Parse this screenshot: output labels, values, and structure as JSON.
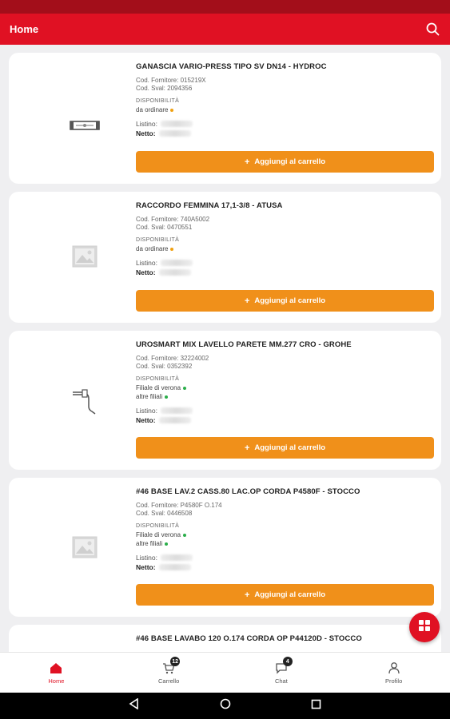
{
  "app_bar": {
    "title": "Home"
  },
  "card_labels": {
    "disponibilita": "DISPONIBILITÀ",
    "listino": "Listino:",
    "netto": "Netto:",
    "add_to_cart": "Aggiungi al carrello"
  },
  "products": [
    {
      "title": "GANASCIA VARIO-PRESS TIPO SV DN14 - HYDROC",
      "cod_fornitore": "Cod. Fornitore: 015219X",
      "cod_sval": "Cod. Sval: 2094356",
      "availability": [
        {
          "text": "da ordinare",
          "status": "orange"
        }
      ],
      "image": "pipe-clamp-image"
    },
    {
      "title": "RACCORDO FEMMINA 17,1-3/8 - ATUSA",
      "cod_fornitore": "Cod. Fornitore: 740A5002",
      "cod_sval": "Cod. Sval: 0470551",
      "availability": [
        {
          "text": "da ordinare",
          "status": "orange"
        }
      ],
      "image": "placeholder-image"
    },
    {
      "title": "UROSMART MIX LAVELLO PARETE MM.277 CRO - GROHE",
      "cod_fornitore": "Cod. Fornitore: 32224002",
      "cod_sval": "Cod. Sval: 0352392",
      "availability": [
        {
          "text": "Filiale di verona",
          "status": "green"
        },
        {
          "text": "altre filiali",
          "status": "green"
        }
      ],
      "image": "faucet-image"
    },
    {
      "title": "#46 BASE LAV.2 CASS.80 LAC.OP CORDA P4580F - STOCCO",
      "cod_fornitore": "Cod. Fornitore: P4580F O.174",
      "cod_sval": "Cod. Sval: 0446508",
      "availability": [
        {
          "text": "Filiale di verona",
          "status": "green"
        },
        {
          "text": "altre filiali",
          "status": "green"
        }
      ],
      "image": "placeholder-image"
    },
    {
      "title": "#46 BASE LAVABO 120 O.174 CORDA OP P44120D - STOCCO"
    }
  ],
  "bottom_nav": {
    "home": "Home",
    "carrello": "Carrello",
    "carrello_badge": "12",
    "chat": "Chat",
    "chat_badge": "4",
    "profilo": "Profilo"
  },
  "colors": {
    "primary": "#e01123",
    "accent": "#f0901a",
    "status_bar": "#a30e1a"
  }
}
